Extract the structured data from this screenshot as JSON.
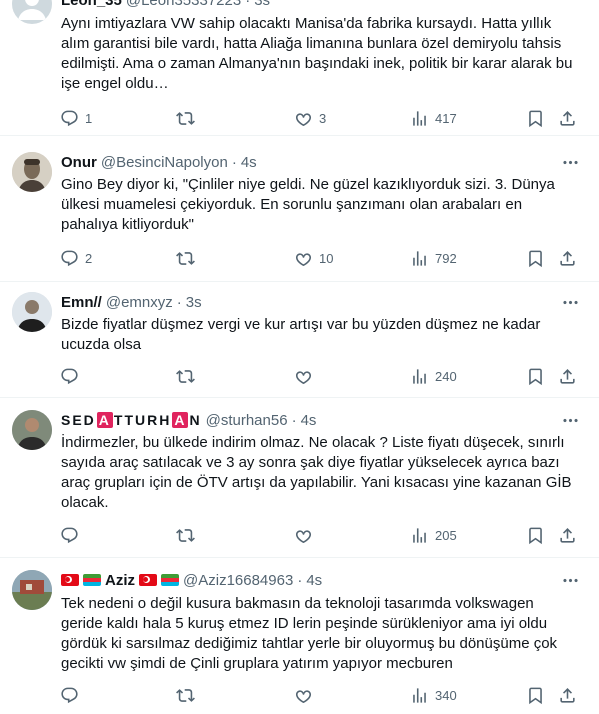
{
  "tweets": [
    {
      "name": "Leon_35",
      "handle": "@Leon35337223",
      "time": "3s",
      "text": "Aynı imtiyazlara VW sahip olacaktı Manisa'da fabrika kursaydı. Hatta yıllık alım garantisi bile vardı, hatta Aliağa limanına bunlara özel demiryolu tahsis edilmişti. Ama o zaman Almanya'nın başındaki inek, politik bir karar alarak bu işe engel oldu…",
      "replies": "1",
      "retweets": "",
      "likes": "3",
      "views": "417",
      "avatar": "default-avatar-icon"
    },
    {
      "name": "Onur",
      "handle": "@BesinciNapolyon",
      "time": "4s",
      "text": "Gino Bey diyor ki, \"Çinliler niye geldi. Ne güzel kazıklıyorduk sizi. 3. Dünya ülkesi muamelesi çekiyorduk. En sorunlu şanzımanı olan arabaları en pahalıya kitliyorduk\"",
      "replies": "2",
      "retweets": "",
      "likes": "10",
      "views": "792",
      "avatar": "portrait-avatar"
    },
    {
      "name": "Emn//",
      "handle": "@emnxyz",
      "time": "3s",
      "text": "Bizde fiyatlar düşmez vergi ve kur artışı var bu yüzden düşmez ne kadar ucuzda olsa",
      "replies": "",
      "retweets": "",
      "likes": "",
      "views": "240",
      "avatar": "person-avatar"
    },
    {
      "name_parts": [
        "SED",
        "A",
        "TTURH",
        "A",
        "N"
      ],
      "handle": "@sturhan56",
      "time": "4s",
      "text": "İndirmezler, bu ülkede indirim olmaz. Ne olacak ? Liste fiyatı düşecek, sınırlı sayıda araç satılacak ve 3 ay sonra şak diye fiyatlar yükselecek ayrıca bazı araç grupları için de ÖTV artışı da yapılabilir. Yani kısacası yine kazanan GİB olacak.",
      "replies": "",
      "retweets": "",
      "likes": "",
      "views": "205",
      "avatar": "person-avatar"
    },
    {
      "name": "Aziz",
      "handle": "@Aziz16684963",
      "time": "4s",
      "text": "Tek nedeni o değil kusura bakmasın da teknoloji tasarımda volkswagen geride kaldı hala 5 kuruş etmez ID lerin peşinde sürükleniyor ama iyi oldu gördük ki sarsılmaz dediğimiz tahtlar yerle bir oluyormuş bu dönüşüme çok gecikti vw şimdi de Çinli gruplara yatırım yapıyor mecburen",
      "replies": "",
      "retweets": "",
      "likes": "",
      "views": "340",
      "avatar": "landscape-avatar"
    }
  ],
  "colors": {
    "text": "#0f1419",
    "secondary": "#536471",
    "divider": "#eff3f4",
    "brand_box": "#e0245e"
  },
  "separator": "·"
}
